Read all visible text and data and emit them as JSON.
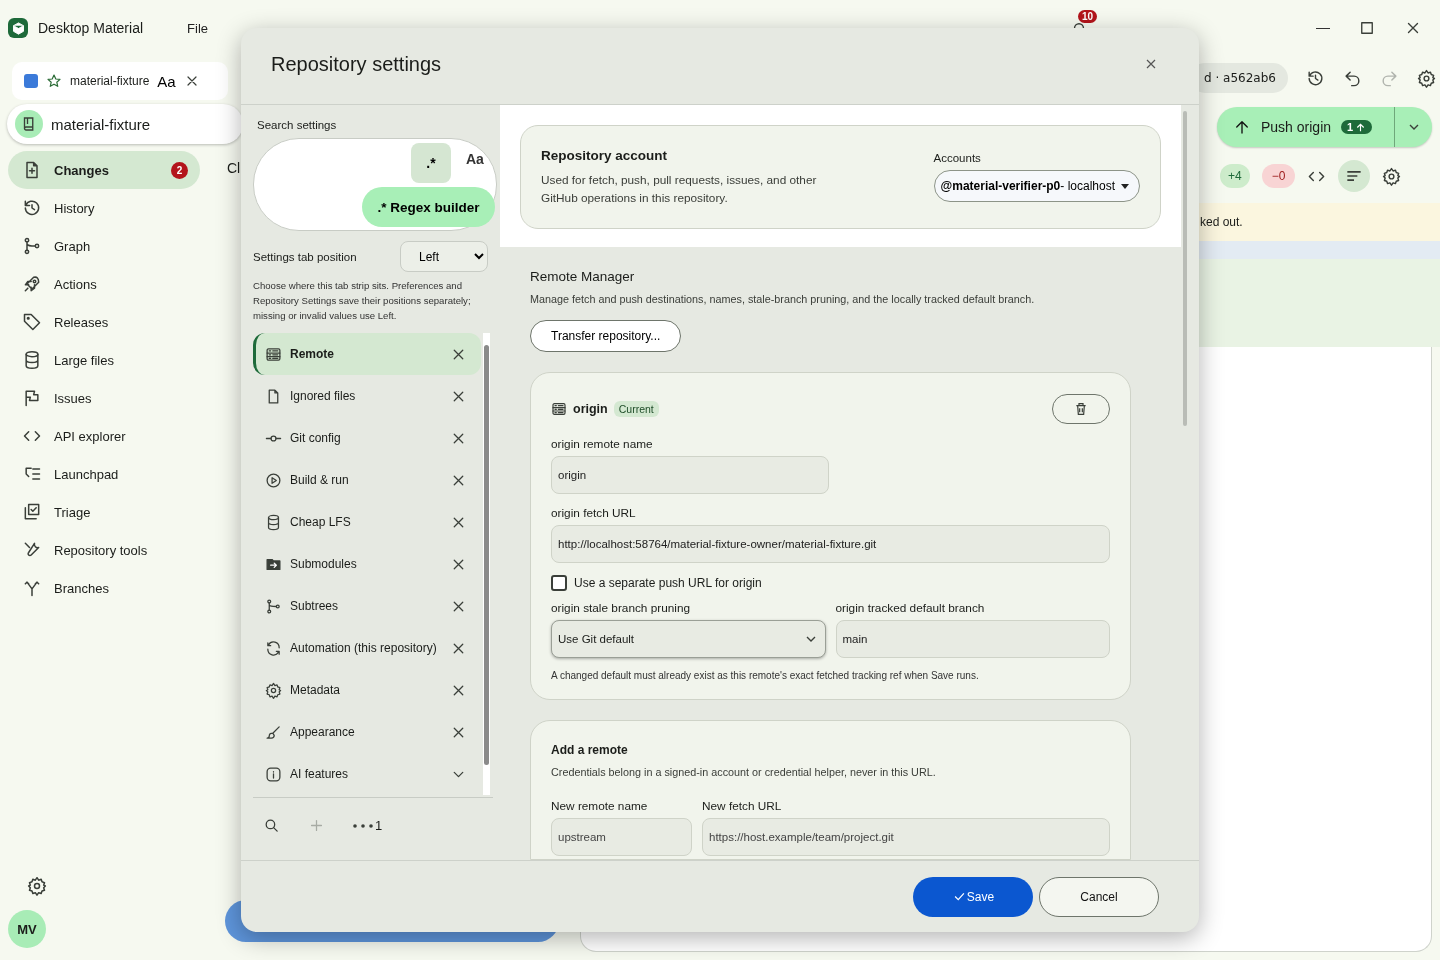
{
  "app": {
    "title": "Desktop Material",
    "menu": [
      "File"
    ],
    "notification_count": "10"
  },
  "repo_tab": {
    "label": "material-fixture",
    "font_toggle": "Aa"
  },
  "repo": {
    "name": "material-fixture"
  },
  "nav": [
    {
      "label": "Changes",
      "badge": "2",
      "selected": true
    },
    {
      "label": "History",
      "selected": false
    },
    {
      "label": "Graph",
      "selected": false
    },
    {
      "label": "Actions",
      "selected": false
    },
    {
      "label": "Releases",
      "selected": false
    },
    {
      "label": "Large files",
      "selected": false
    },
    {
      "label": "Issues",
      "selected": false
    },
    {
      "label": "API explorer",
      "selected": false
    },
    {
      "label": "Launchpad",
      "selected": false
    },
    {
      "label": "Triage",
      "selected": false
    },
    {
      "label": "Repository tools",
      "selected": false
    },
    {
      "label": "Branches",
      "selected": false
    }
  ],
  "user": {
    "initials": "MV"
  },
  "background": {
    "heading": "Cl",
    "commit": "d · a562ab6",
    "push": {
      "label": "Push origin",
      "count": "1"
    },
    "additions": "+4",
    "deletions": "−0",
    "banner": "ked out."
  },
  "dialog": {
    "title": "Repository settings",
    "search": {
      "label": "Search settings",
      "regex_toggle": ".*",
      "regex_on": true,
      "case_toggle": "Aa",
      "regex_builder": "Regex builder",
      "regex_builder_icon": ".*"
    },
    "tab_position": {
      "label": "Settings tab position",
      "value": "Left",
      "help": "Choose where this tab strip sits. Preferences and Repository Settings save their positions separately; missing or invalid values use Left."
    },
    "tabs": [
      {
        "label": "Remote",
        "selected": true
      },
      {
        "label": "Ignored files",
        "selected": false
      },
      {
        "label": "Git config",
        "selected": false
      },
      {
        "label": "Build & run",
        "selected": false
      },
      {
        "label": "Cheap LFS",
        "selected": false
      },
      {
        "label": "Submodules",
        "selected": false
      },
      {
        "label": "Subtrees",
        "selected": false
      },
      {
        "label": "Automation (this repository)",
        "selected": false
      },
      {
        "label": "Metadata",
        "selected": false
      },
      {
        "label": "Appearance",
        "selected": false
      },
      {
        "label": "AI features",
        "selected": false
      }
    ],
    "hidden_tabs_count": "1",
    "account": {
      "title": "Repository account",
      "description": "Used for fetch, push, pull requests, issues, and other GitHub operations in this repository.",
      "accounts_label": "Accounts",
      "account_user": "@material-verifier-p0",
      "account_host": " - localhost"
    },
    "remote_manager": {
      "title": "Remote Manager",
      "description": "Manage fetch and push destinations, names, stale-branch pruning, and the locally tracked default branch.",
      "transfer_button": "Transfer repository..."
    },
    "remotes": [
      {
        "name": "origin",
        "tag": "Current",
        "name_label": "origin remote name",
        "name_value": "origin",
        "fetch_label": "origin fetch URL",
        "fetch_value": "http://localhost:58764/material-fixture-owner/material-fixture.git",
        "separate_push": {
          "label": "Use a separate push URL for origin",
          "checked": false
        },
        "pruning_label": "origin stale branch pruning",
        "pruning_value": "Use Git default",
        "branch_label": "origin tracked default branch",
        "branch_value": "main",
        "note": "A changed default must already exist as this remote's exact fetched tracking ref when Save runs."
      }
    ],
    "add_remote": {
      "title": "Add a remote",
      "description": "Credentials belong in a signed-in account or credential helper, never in this URL.",
      "name_label": "New remote name",
      "name_placeholder": "upstream",
      "url_label": "New fetch URL",
      "url_placeholder": "https://host.example/team/project.git"
    },
    "buttons": [
      {
        "label": "Save",
        "kind": "primary"
      },
      {
        "label": "Cancel",
        "kind": "secondary"
      }
    ]
  }
}
